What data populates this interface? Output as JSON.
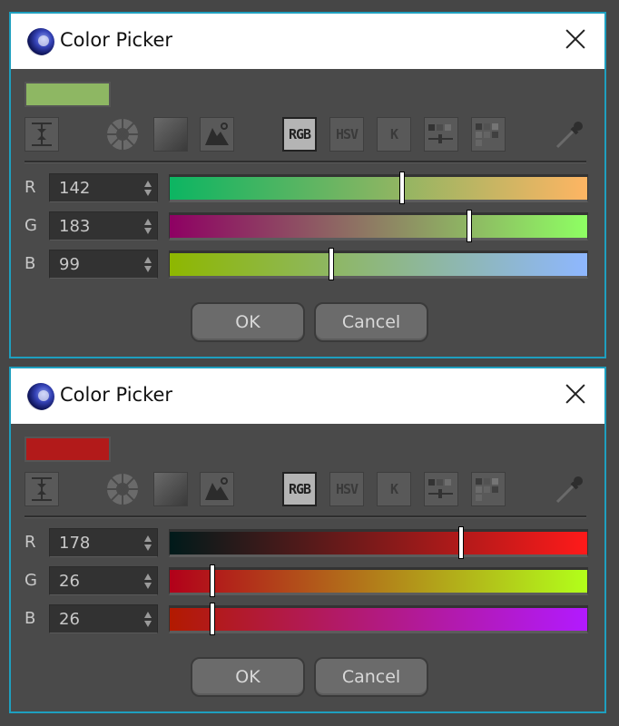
{
  "dialogs": [
    {
      "title": "Color Picker",
      "swatch_color": "#8eb763",
      "mode_buttons": {
        "rgb": "RGB",
        "hsv": "HSV",
        "k": "K"
      },
      "active_mode": "RGB",
      "channels": [
        {
          "label": "R",
          "value": "142",
          "fraction": 0.557,
          "gradient": [
            "#0cb562",
            "#feb563"
          ]
        },
        {
          "label": "G",
          "value": "183",
          "fraction": 0.718,
          "gradient": [
            "#8e0063",
            "#8eff63"
          ]
        },
        {
          "label": "B",
          "value": "99",
          "fraction": 0.388,
          "gradient": [
            "#8eb700",
            "#8eb7ff"
          ]
        }
      ],
      "ok_label": "OK",
      "cancel_label": "Cancel"
    },
    {
      "title": "Color Picker",
      "swatch_color": "#b21a1a",
      "mode_buttons": {
        "rgb": "RGB",
        "hsv": "HSV",
        "k": "K"
      },
      "active_mode": "RGB",
      "channels": [
        {
          "label": "R",
          "value": "178",
          "fraction": 0.698,
          "gradient": [
            "#001a1a",
            "#ff1a1a"
          ]
        },
        {
          "label": "G",
          "value": "26",
          "fraction": 0.102,
          "gradient": [
            "#b2001a",
            "#b2ff1a"
          ]
        },
        {
          "label": "B",
          "value": "26",
          "fraction": 0.102,
          "gradient": [
            "#b21a00",
            "#b21aff"
          ]
        }
      ],
      "ok_label": "OK",
      "cancel_label": "Cancel"
    }
  ],
  "icons": [
    "app-logo-icon",
    "close-icon",
    "fit-height-icon",
    "color-wheel-icon",
    "gradient-square-icon",
    "image-picture-icon",
    "rgb-mode-icon",
    "hsv-mode-icon",
    "kelvin-mode-icon",
    "mixer-icon",
    "swatches-icon",
    "eyedropper-icon",
    "spinner-arrows-icon"
  ]
}
